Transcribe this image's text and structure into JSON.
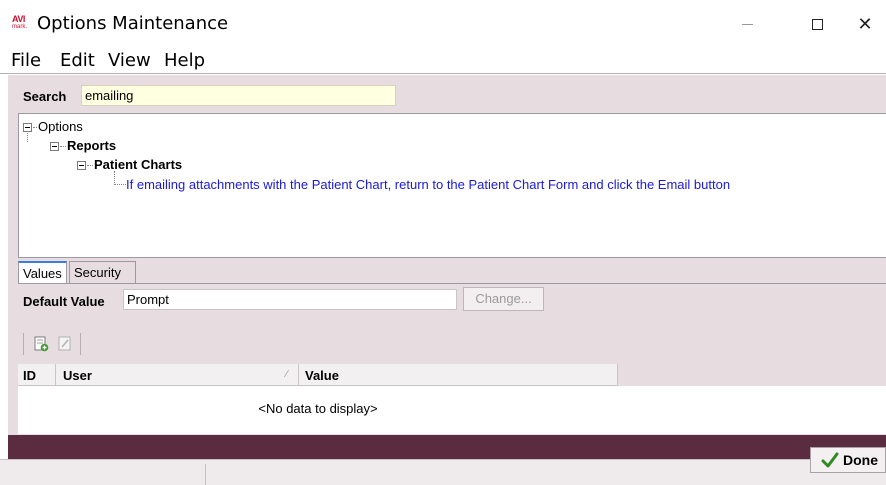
{
  "window": {
    "logo_top": "AVI",
    "logo_bottom": "mark.",
    "title": "Options Maintenance",
    "controls": {
      "minimize": "—",
      "maximize": "□",
      "close": "✕"
    }
  },
  "menu": {
    "items": [
      {
        "label": "File"
      },
      {
        "label": "Edit"
      },
      {
        "label": "View"
      },
      {
        "label": "Help"
      }
    ]
  },
  "search": {
    "label": "Search",
    "value": "emailing"
  },
  "tree": {
    "root": "Options",
    "level1": "Reports",
    "level2": "Patient Charts",
    "leaf": "If emailing attachments with the Patient Chart, return to the Patient Chart Form and click the Email button"
  },
  "tabs": [
    {
      "label": "Values",
      "active": true
    },
    {
      "label": "Security",
      "active": false
    }
  ],
  "values": {
    "default_label": "Default Value",
    "default_value": "Prompt",
    "change_button": "Change..."
  },
  "toolbar": {
    "icons": [
      "add-record-icon",
      "edit-record-icon"
    ]
  },
  "grid": {
    "columns": [
      "ID",
      "User",
      "Value"
    ],
    "sort_indicator": "∕",
    "empty_text": "<No data to display>"
  },
  "footer": {
    "done_label": "Done"
  },
  "colors": {
    "panel_bg": "#e7dde1",
    "footer_strip": "#5b2b40",
    "help_text": "#1a1adc",
    "search_bg": "#ffffe1",
    "tab_accent": "#3d7de0",
    "done_check": "#2e8b1f"
  }
}
